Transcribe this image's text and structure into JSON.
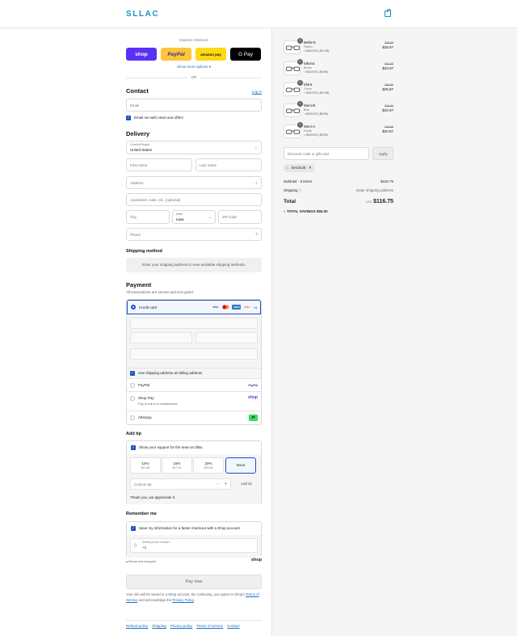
{
  "header": {
    "logo": "SLLAC"
  },
  "express": {
    "title": "Express checkout",
    "buttons": {
      "shop": "shop",
      "paypal": "PayPal",
      "amazon": "amazon pay",
      "gpay": "G Pay"
    },
    "more": "Show more options",
    "or": "OR"
  },
  "contact": {
    "title": "Contact",
    "login": "Log in",
    "email_placeholder": "Email",
    "news_label": "Email me with news and offers"
  },
  "delivery": {
    "title": "Delivery",
    "country_label": "Country/Region",
    "country_value": "United States",
    "first_name": "First name",
    "last_name": "Last name",
    "address": "Address",
    "apartment": "Apartment, suite, etc. (optional)",
    "city": "City",
    "state_label": "State",
    "state_value": "Iowa",
    "zip": "ZIP code",
    "phone": "Phone"
  },
  "shipping": {
    "title": "Shipping method",
    "message": "Enter your shipping address to view available shipping methods."
  },
  "payment": {
    "title": "Payment",
    "subtitle": "All transactions are secure and encrypted.",
    "credit_card": "Credit card",
    "cards": {
      "visa": "VISA",
      "mc": "MC",
      "amex": "AMEX",
      "discover": "DISC",
      "more": "+4"
    },
    "billing_label": "Use shipping address as billing address",
    "paypal": "PayPal",
    "paypal_logo": "PayPal",
    "shop_pay": "Shop Pay",
    "shop_pay_sub": "Pay in full or in installments",
    "shop_logo": "shop",
    "afterpay": "Afterpay"
  },
  "tip": {
    "title": "Add tip",
    "support_label": "Show your support for the team at Sllac",
    "options": [
      {
        "pct": "10%",
        "amt": "$11.68"
      },
      {
        "pct": "15%",
        "amt": "$17.51"
      },
      {
        "pct": "20%",
        "amt": "$23.35"
      }
    ],
    "none": "None",
    "custom_placeholder": "Custom tip",
    "minus": "−",
    "plus": "+",
    "add_button": "Add tip",
    "thanks": "Thank you, we appreciate it."
  },
  "remember": {
    "title": "Remember me",
    "save_label": "Save my information for a faster checkout with a Shop account",
    "mobile_label": "Mobile phone number",
    "mobile_value": "+1",
    "secure": "Secure and encrypted",
    "shop_logo": "shop"
  },
  "paynow": "Pay now",
  "terms": {
    "part1": "Your info will be saved to a Shop account. By continuing, you agree to Shop's ",
    "tos": "Terms of Service",
    "part2": " and acknowledge the ",
    "privacy": "Privacy Policy",
    "part3": "."
  },
  "footer": {
    "links": [
      "Refund policy",
      "Shipping",
      "Privacy policy",
      "Terms of service",
      "Contact"
    ]
  },
  "cart": {
    "items": [
      {
        "name": "Bella-D",
        "color": "Pattern",
        "code": "BACK30 (-$11.08)",
        "orig": "$36.95",
        "price": "$25.87",
        "qty": "1"
      },
      {
        "name": "Iakona",
        "color": "Brown",
        "code": "BACK30 (-$9.88)",
        "orig": "$32.95",
        "price": "$23.07",
        "qty": "1"
      },
      {
        "name": "Idora",
        "color": "Green",
        "code": "BACK30 (-$11.08)",
        "orig": "$36.95",
        "price": "$25.87",
        "qty": "1"
      },
      {
        "name": "Moni-B",
        "color": "Blue",
        "code": "BACK30 (-$8.98)",
        "orig": "$29.95",
        "price": "$20.97",
        "qty": "1"
      },
      {
        "name": "Moni-A",
        "color": "Purple",
        "code": "BACK30 (-$8.98)",
        "orig": "$29.95",
        "price": "$20.97",
        "qty": "1"
      }
    ],
    "discount_placeholder": "Discount code or gift card",
    "apply": "Apply",
    "applied_code": "BACK30",
    "subtotal_label": "Subtotal · 5 items",
    "subtotal_value": "$116.75",
    "shipping_label": "Shipping",
    "shipping_value": "Enter shipping address",
    "total_label": "Total",
    "currency": "USD",
    "total_value": "$116.75",
    "savings": "TOTAL SAVINGS  $50.00"
  }
}
